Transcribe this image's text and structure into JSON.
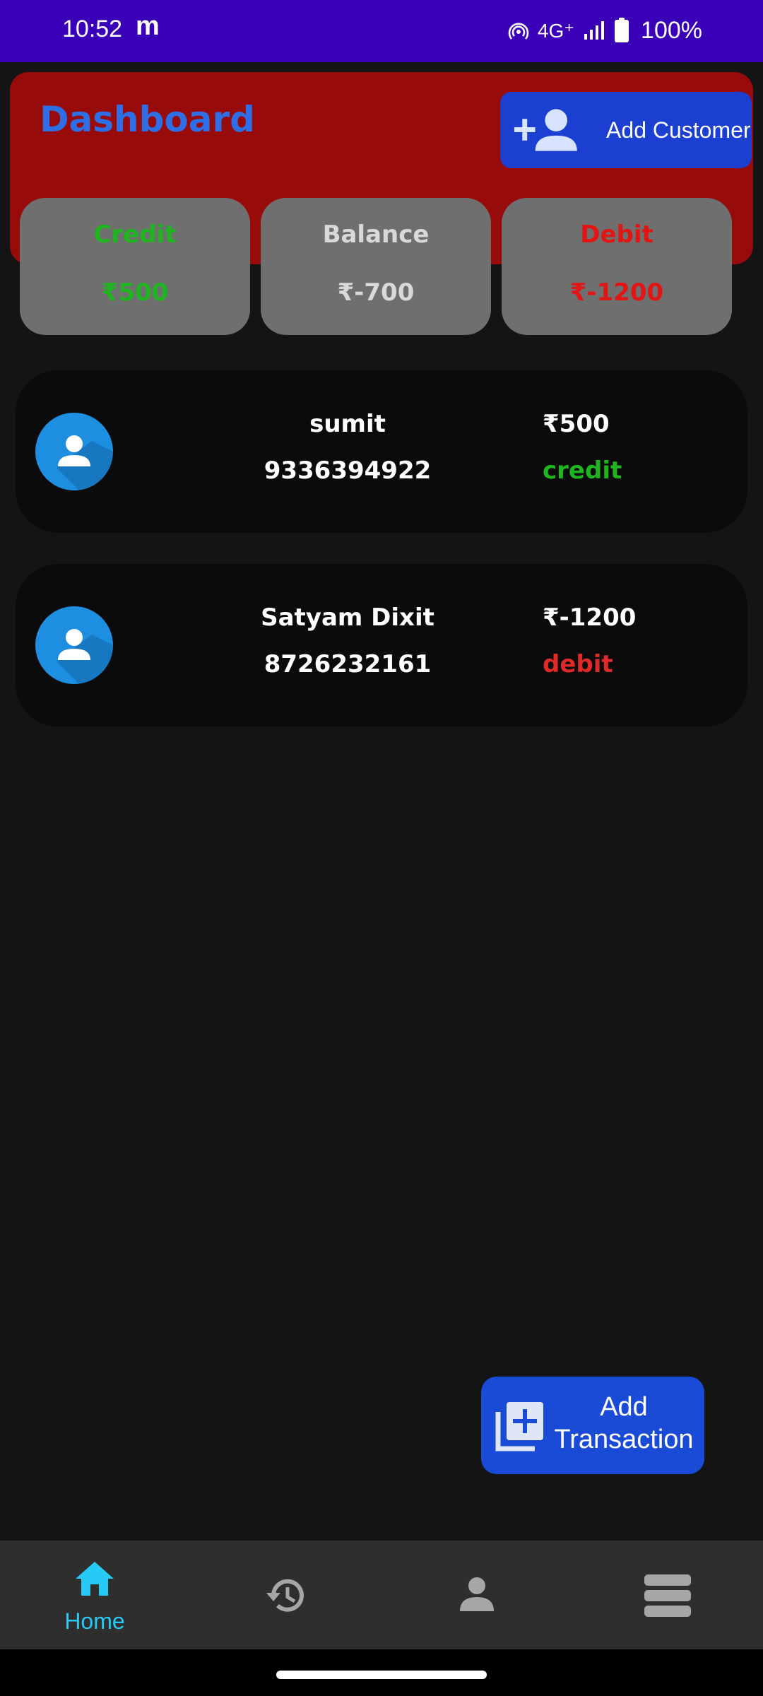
{
  "status_bar": {
    "time": "10:52",
    "app_glyph": "m",
    "network": "4G⁺",
    "battery": "100%",
    "icons": [
      "hotspot-icon",
      "signal-icon",
      "battery-icon"
    ]
  },
  "header": {
    "title": "Dashboard",
    "add_customer_label": "Add Customer",
    "background_color": "#980b0b",
    "title_color": "#2f6fe6"
  },
  "summary": {
    "credit": {
      "label": "Credit",
      "value": "₹500",
      "color": "#1fb51f"
    },
    "balance": {
      "label": "Balance",
      "value": "₹-700",
      "color": "#d9d9d9"
    },
    "debit": {
      "label": "Debit",
      "value": "₹-1200",
      "color": "#e31414"
    }
  },
  "customers": [
    {
      "name": "sumit",
      "phone": "9336394922",
      "amount": "₹500",
      "type": "credit",
      "type_color": "#1fb51f"
    },
    {
      "name": "Satyam Dixit",
      "phone": "8726232161",
      "amount": "₹-1200",
      "type": "debit",
      "type_color": "#e02a2a"
    }
  ],
  "fab": {
    "label": "Add Transaction"
  },
  "bottom_nav": {
    "items": [
      {
        "icon": "home-icon",
        "label": "Home",
        "active": true
      },
      {
        "icon": "history-icon",
        "label": "",
        "active": false
      },
      {
        "icon": "person-icon",
        "label": "",
        "active": false
      },
      {
        "icon": "menu-icon",
        "label": "",
        "active": false
      }
    ],
    "active_color": "#27c9f5"
  }
}
